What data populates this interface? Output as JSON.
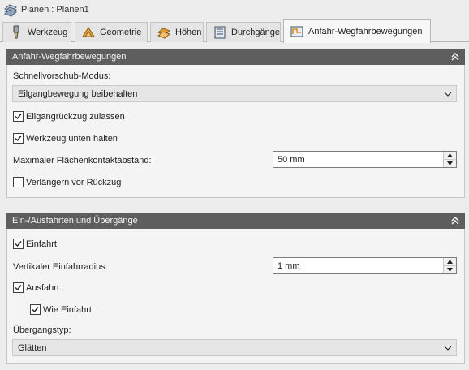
{
  "window": {
    "title": "Planen : Planen1",
    "title_icon": "planes-icon"
  },
  "tabs": [
    {
      "label": "Werkzeug",
      "icon": "tool-icon",
      "active": false
    },
    {
      "label": "Geometrie",
      "icon": "geometry-icon",
      "active": false
    },
    {
      "label": "Höhen",
      "icon": "heights-icon",
      "active": false
    },
    {
      "label": "Durchgänge",
      "icon": "passes-icon",
      "active": false
    },
    {
      "label": "Anfahr-Wegfahrbewegungen",
      "icon": "linking-icon",
      "active": true
    }
  ],
  "section1": {
    "title": "Anfahr-Wegfahrbewegungen",
    "rapid_mode_label": "Schnellvorschub-Modus:",
    "rapid_mode_value": "Eilgangbewegung beibehalten",
    "allow_retract_label": "Eilgangrückzug zulassen",
    "allow_retract_checked": true,
    "keep_tool_down_label": "Werkzeug unten halten",
    "keep_tool_down_checked": true,
    "max_distance_label": "Maximaler Flächenkontaktabstand:",
    "max_distance_value": "50 mm",
    "extend_before_retract_label": "Verlängern vor Rückzug",
    "extend_before_retract_checked": false
  },
  "section2": {
    "title": "Ein-/Ausfahrten und Übergänge",
    "lead_in_label": "Einfahrt",
    "lead_in_checked": true,
    "vertical_radius_label": "Vertikaler Einfahrradius:",
    "vertical_radius_value": "1 mm",
    "lead_out_label": "Ausfahrt",
    "lead_out_checked": true,
    "same_as_lead_in_label": "Wie Einfahrt",
    "same_as_lead_in_checked": true,
    "transition_type_label": "Übergangstyp:",
    "transition_type_value": "Glätten"
  },
  "colors": {
    "header_bg": "#5e5e5e",
    "panel_bg": "#f4f4f4",
    "window_bg": "#ededed"
  }
}
